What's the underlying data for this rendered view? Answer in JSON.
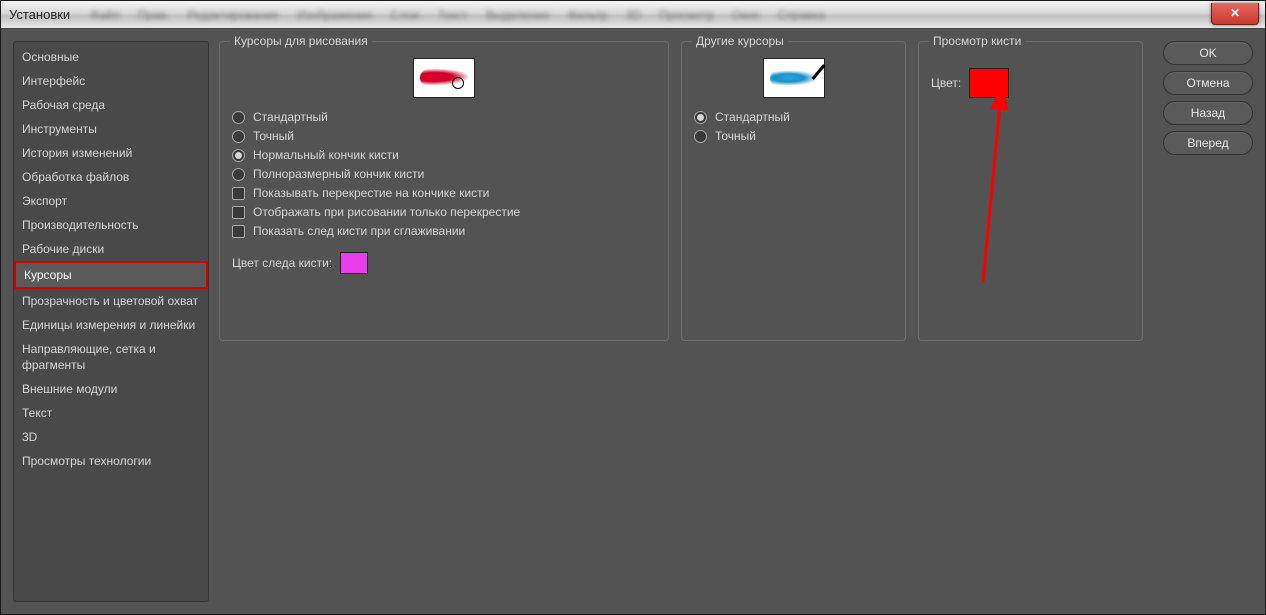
{
  "window": {
    "title": "Установки"
  },
  "blurredMenu": [
    "Файл",
    "Прав.",
    "Редактирование",
    "Изображение",
    "Слои",
    "Текст",
    "Выделение",
    "Фильтр",
    "3D",
    "Просмотр",
    "Окно",
    "Справка"
  ],
  "sidebar": {
    "items": [
      "Основные",
      "Интерфейс",
      "Рабочая среда",
      "Инструменты",
      "История изменений",
      "Обработка файлов",
      "Экспорт",
      "Производительность",
      "Рабочие диски",
      "Курсоры",
      "Прозрачность и цветовой охват",
      "Единицы измерения и линейки",
      "Направляющие, сетка и фрагменты",
      "Внешние модули",
      "Текст",
      "3D",
      "Просмотры технологии"
    ],
    "selectedIndex": 9
  },
  "panel1": {
    "legend": "Курсоры для рисования",
    "radios": [
      "Стандартный",
      "Точный",
      "Нормальный кончик кисти",
      "Полноразмерный кончик кисти"
    ],
    "radioSelected": 2,
    "checks": [
      "Показывать перекрестие на кончике кисти",
      "Отображать при рисовании только перекрестие",
      "Показать след кисти при сглаживании"
    ],
    "trailLabel": "Цвет следа кисти:",
    "trailColor": "#e93ee9"
  },
  "panel2": {
    "legend": "Другие курсоры",
    "radios": [
      "Стандартный",
      "Точный"
    ],
    "radioSelected": 0
  },
  "panel3": {
    "legend": "Просмотр кисти",
    "colorLabel": "Цвет:",
    "color": "#ff0000"
  },
  "buttons": {
    "ok": "OK",
    "cancel": "Отмена",
    "back": "Назад",
    "forward": "Вперед"
  }
}
